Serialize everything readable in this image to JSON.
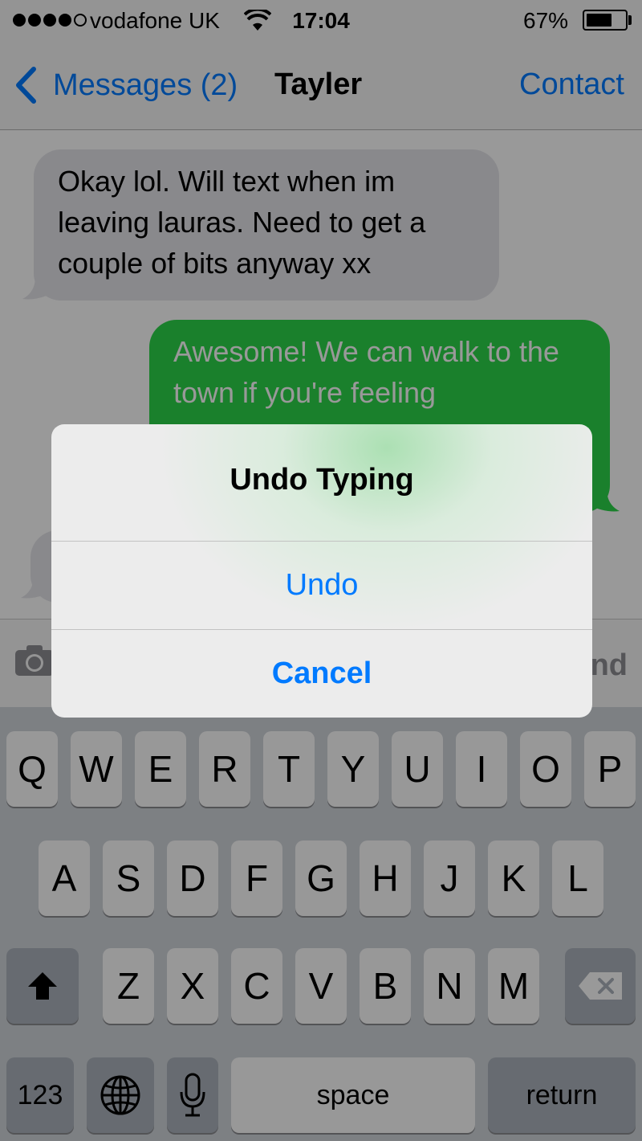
{
  "status_bar": {
    "carrier": "vodafone UK",
    "time": "17:04",
    "battery_percent": "67%",
    "battery_level": 0.67,
    "signal_bars": 4,
    "signal_total": 5
  },
  "nav": {
    "back_label": "Messages (2)",
    "title": "Tayler",
    "contact_label": "Contact"
  },
  "messages": [
    {
      "direction": "received",
      "text": "Okay lol. Will text when im leaving lauras. Need to get a couple of bits anyway xx"
    },
    {
      "direction": "sent",
      "text": "Awesome! We can walk to the town if you're feeling"
    }
  ],
  "input_bar": {
    "send_label": "Send",
    "camera_icon": "camera-icon"
  },
  "alert": {
    "title": "Undo Typing",
    "buttons": [
      "Undo",
      "Cancel"
    ]
  },
  "keyboard": {
    "row1": [
      "Q",
      "W",
      "E",
      "R",
      "T",
      "Y",
      "U",
      "I",
      "O",
      "P"
    ],
    "row2": [
      "A",
      "S",
      "D",
      "F",
      "G",
      "H",
      "J",
      "K",
      "L"
    ],
    "row3": [
      "Z",
      "X",
      "C",
      "V",
      "B",
      "N",
      "M"
    ],
    "numbers_label": "123",
    "space_label": "space",
    "return_label": "return",
    "icons": [
      "shift-icon",
      "delete-icon",
      "globe-icon",
      "microphone-icon"
    ]
  },
  "colors": {
    "ios_blue": "#007aff",
    "sent_bubble": "#2cd64a",
    "received_bubble": "#e5e5ea"
  }
}
